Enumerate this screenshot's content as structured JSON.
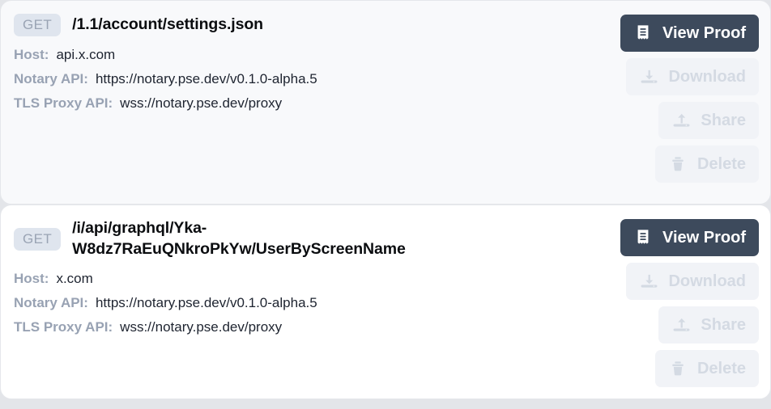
{
  "requests": [
    {
      "method": "GET",
      "endpoint": "/1.1/account/settings.json",
      "fields": [
        {
          "label": "Host:",
          "value": "api.x.com"
        },
        {
          "label": "Notary API:",
          "value": "https://notary.pse.dev/v0.1.0-alpha.5"
        },
        {
          "label": "TLS Proxy API:",
          "value": "wss://notary.pse.dev/proxy"
        }
      ],
      "actions": [
        {
          "label": "View Proof",
          "icon": "receipt-icon",
          "state": "enabled"
        },
        {
          "label": "Download",
          "icon": "download-icon",
          "state": "disabled"
        },
        {
          "label": "Share",
          "icon": "share-icon",
          "state": "disabled"
        },
        {
          "label": "Delete",
          "icon": "trash-icon",
          "state": "disabled"
        }
      ]
    },
    {
      "method": "GET",
      "endpoint": "/i/api/graphql/Yka-W8dz7RaEuQNkroPkYw/UserByScreenName",
      "fields": [
        {
          "label": "Host:",
          "value": "x.com"
        },
        {
          "label": "Notary API:",
          "value": "https://notary.pse.dev/v0.1.0-alpha.5"
        },
        {
          "label": "TLS Proxy API:",
          "value": "wss://notary.pse.dev/proxy"
        }
      ],
      "actions": [
        {
          "label": "View Proof",
          "icon": "receipt-icon",
          "state": "enabled"
        },
        {
          "label": "Download",
          "icon": "download-icon",
          "state": "disabled"
        },
        {
          "label": "Share",
          "icon": "share-icon",
          "state": "disabled"
        },
        {
          "label": "Delete",
          "icon": "trash-icon",
          "state": "disabled"
        }
      ]
    }
  ],
  "colors": {
    "primary_button": "#3d4a5c",
    "disabled_button_bg": "#f1f3f7",
    "disabled_button_text": "#d4dae3",
    "badge_bg": "#dfe5ee",
    "badge_text": "#9aa4b4",
    "label_text": "#98a2b3",
    "value_text": "#1e2430",
    "card_muted_bg": "#f8f9fb",
    "card_plain_bg": "#ffffff",
    "page_bg": "#e3e5e9"
  }
}
